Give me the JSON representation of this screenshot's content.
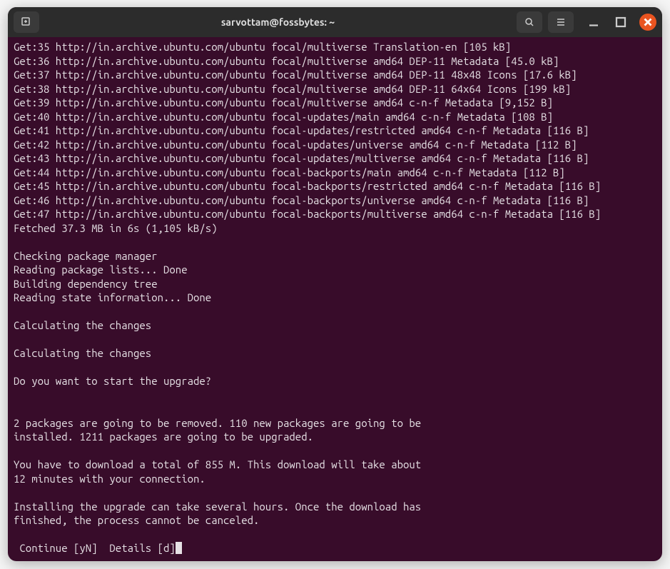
{
  "window": {
    "title": "sarvottam@fossbytes: ~"
  },
  "terminal": {
    "lines": [
      "Get:35 http://in.archive.ubuntu.com/ubuntu focal/multiverse Translation-en [105 kB]",
      "Get:36 http://in.archive.ubuntu.com/ubuntu focal/multiverse amd64 DEP-11 Metadata [45.0 kB]",
      "Get:37 http://in.archive.ubuntu.com/ubuntu focal/multiverse amd64 DEP-11 48x48 Icons [17.6 kB]",
      "Get:38 http://in.archive.ubuntu.com/ubuntu focal/multiverse amd64 DEP-11 64x64 Icons [199 kB]",
      "Get:39 http://in.archive.ubuntu.com/ubuntu focal/multiverse amd64 c-n-f Metadata [9,152 B]",
      "Get:40 http://in.archive.ubuntu.com/ubuntu focal-updates/main amd64 c-n-f Metadata [108 B]",
      "Get:41 http://in.archive.ubuntu.com/ubuntu focal-updates/restricted amd64 c-n-f Metadata [116 B]",
      "Get:42 http://in.archive.ubuntu.com/ubuntu focal-updates/universe amd64 c-n-f Metadata [112 B]",
      "Get:43 http://in.archive.ubuntu.com/ubuntu focal-updates/multiverse amd64 c-n-f Metadata [116 B]",
      "Get:44 http://in.archive.ubuntu.com/ubuntu focal-backports/main amd64 c-n-f Metadata [112 B]",
      "Get:45 http://in.archive.ubuntu.com/ubuntu focal-backports/restricted amd64 c-n-f Metadata [116 B]",
      "Get:46 http://in.archive.ubuntu.com/ubuntu focal-backports/universe amd64 c-n-f Metadata [116 B]",
      "Get:47 http://in.archive.ubuntu.com/ubuntu focal-backports/multiverse amd64 c-n-f Metadata [116 B]",
      "Fetched 37.3 MB in 6s (1,105 kB/s)",
      "",
      "Checking package manager",
      "Reading package lists... Done",
      "Building dependency tree",
      "Reading state information... Done",
      "",
      "Calculating the changes",
      "",
      "Calculating the changes",
      "",
      "Do you want to start the upgrade?",
      "",
      "",
      "2 packages are going to be removed. 110 new packages are going to be",
      "installed. 1211 packages are going to be upgraded.",
      "",
      "You have to download a total of 855 M. This download will take about",
      "12 minutes with your connection.",
      "",
      "Installing the upgrade can take several hours. Once the download has",
      "finished, the process cannot be canceled.",
      ""
    ],
    "prompt": " Continue [yN]  Details [d]"
  }
}
